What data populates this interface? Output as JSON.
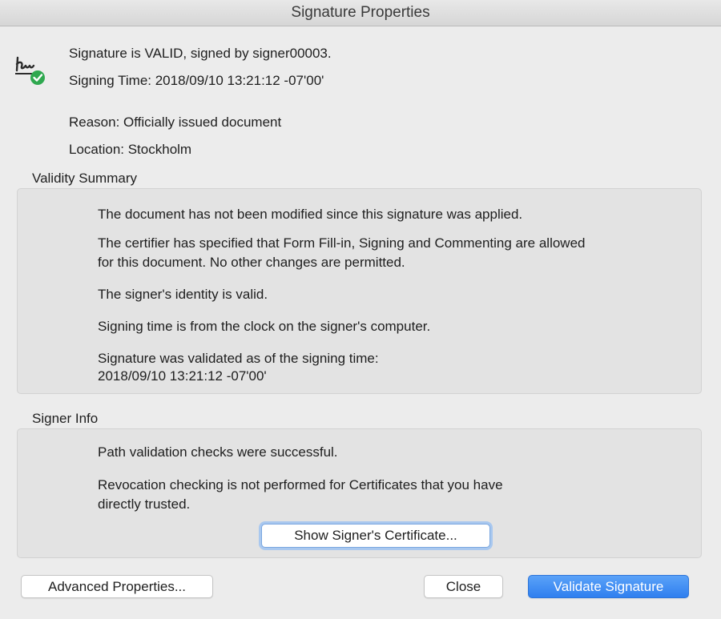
{
  "window": {
    "title": "Signature Properties"
  },
  "icons": {
    "signature": "signature-valid-icon"
  },
  "colors": {
    "accent": "#2f7fef",
    "valid_green": "#2fa84f",
    "panel_bg": "#e3e3e3",
    "window_bg": "#ececec"
  },
  "summary": {
    "status": "Signature is VALID, signed by signer00003.",
    "signing_time": "Signing Time:  2018/09/10 13:21:12 -07'00'",
    "reason": "Reason:  Officially issued document",
    "location": "Location:  Stockholm"
  },
  "validity": {
    "label": "Validity Summary",
    "lines": [
      "The document has not been modified since this signature was applied.",
      "The certifier has specified that Form Fill-in, Signing and Commenting are allowed",
      "for this document. No other changes are permitted.",
      "The signer's identity is valid.",
      "Signing time is from the clock on the signer's computer.",
      "Signature was validated as of the signing time:",
      "2018/09/10 13:21:12 -07'00'"
    ]
  },
  "signer": {
    "label": "Signer Info",
    "lines": [
      "Path validation checks were successful.",
      "Revocation checking is not performed for Certificates that you have",
      "directly trusted."
    ],
    "show_cert_button": "Show Signer's Certificate..."
  },
  "buttons": {
    "advanced": "Advanced Properties...",
    "close": "Close",
    "validate": "Validate Signature"
  }
}
